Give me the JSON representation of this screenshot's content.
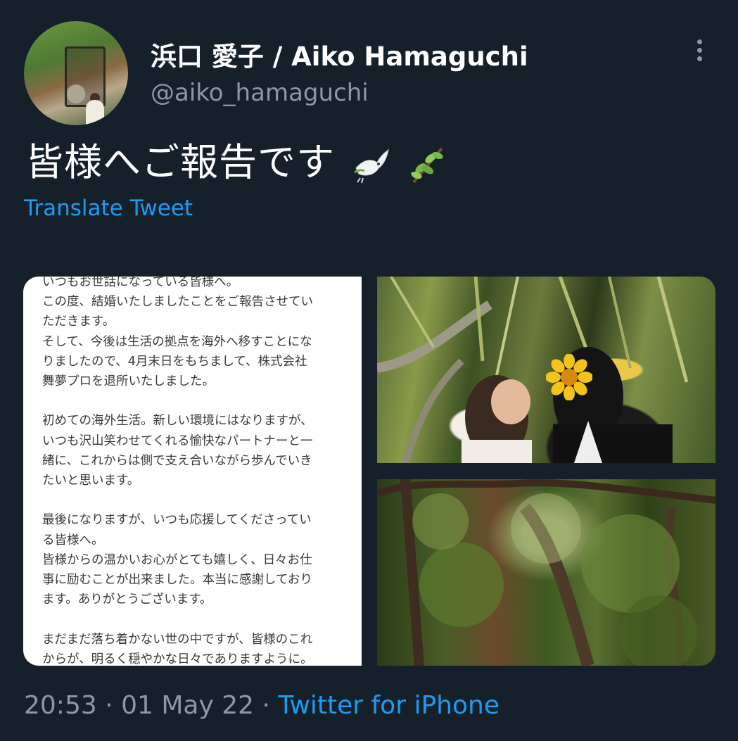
{
  "author": {
    "display_name": "浜口 愛子 / Aiko Hamaguchi",
    "handle": "@aiko_hamaguchi"
  },
  "tweet": {
    "text": "皆様へご報告です",
    "emojis": [
      "🕊",
      "🌿"
    ],
    "translate_label": "Translate Tweet"
  },
  "media": {
    "document_lines": [
      "いつもお世話になっている皆様へ。",
      "この度、結婚いたしましたことをご報告させてい",
      "ただきます。",
      "そして、今後は生活の拠点を海外へ移すことにな",
      "りましたので、4月末日をもちまして、株式会社",
      "舞夢プロを退所いたしました。",
      "",
      "初めての海外生活。新しい環境にはなりますが、",
      "いつも沢山笑わせてくれる愉快なパートナーと一",
      "緒に、これからは側で支え合いながら歩んでいき",
      "たいと思います。",
      "",
      "最後になりますが、いつも応援してくださってい",
      "る皆様へ。",
      "皆様からの温かいお心がとても嬉しく、日々お仕",
      "事に励むことが出来ました。本当に感謝しており",
      "ます。ありがとうございます。",
      "",
      "まだまだ落ち着かない世の中ですが、皆様のこれ",
      "からが、明るく穏やかな日々でありますように。"
    ]
  },
  "meta": {
    "time": "20:53",
    "separator": "·",
    "date": "01 May 22",
    "source": "Twitter for iPhone"
  },
  "colors": {
    "background": "#15202b",
    "accent": "#1d9bf0",
    "secondary_text": "#8b98a5"
  }
}
